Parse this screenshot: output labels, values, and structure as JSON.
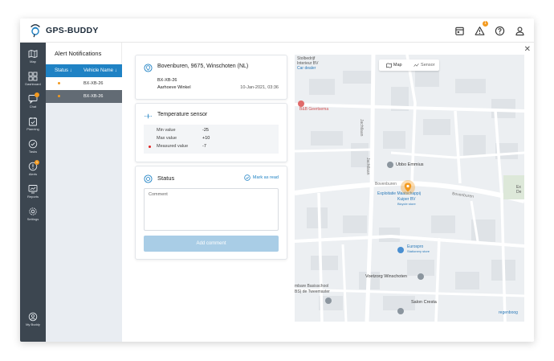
{
  "app": {
    "brand": "GPS-BUDDY",
    "notification_count": "1"
  },
  "topbar": {
    "icons": [
      "calendar-icon",
      "warning-icon",
      "help-icon",
      "user-icon"
    ]
  },
  "sidebar": {
    "items": [
      {
        "label": "Map",
        "icon": "map-icon"
      },
      {
        "label": "Dashboard",
        "icon": "dashboard-icon"
      },
      {
        "label": "Chat",
        "icon": "chat-icon"
      },
      {
        "label": "Planning",
        "icon": "planning-icon"
      },
      {
        "label": "Tasks",
        "icon": "tasks-icon"
      },
      {
        "label": "Alerts",
        "icon": "alerts-icon",
        "badge": "1"
      },
      {
        "label": "Reports",
        "icon": "reports-icon"
      },
      {
        "label": "Settings",
        "icon": "settings-icon"
      }
    ],
    "footer": {
      "label": "My Buddy",
      "icon": "my-buddy-icon"
    }
  },
  "alerts": {
    "title": "Alert Notifications",
    "columns": {
      "status": "Status",
      "vehicle": "Vehicle Name"
    },
    "rows": [
      {
        "vehicle": "BX-XB-26"
      },
      {
        "vehicle": "BX-XB-26"
      }
    ]
  },
  "location": {
    "address": "Bovenburen, 9675, Winschoten (NL)",
    "vehicle": "BX-XB-26",
    "place": "Aarhoeve Winkel",
    "datetime": "10-Jan-2021, 03:36"
  },
  "sensor": {
    "title": "Temperature sensor",
    "rows": [
      {
        "label": "Min value",
        "value": "-25"
      },
      {
        "label": "Max value",
        "value": "+10"
      },
      {
        "label": "Measured value",
        "value": "-7"
      }
    ]
  },
  "status": {
    "title": "Status",
    "mark_read": "Mark as read",
    "comment_placeholder": "Comment",
    "add_button": "Add comment"
  },
  "map": {
    "toggle": {
      "map": "Map",
      "sensor": "Sensor"
    },
    "labels": {
      "bovenburen_1": "Bovenburen",
      "bovenburen_2": "Bovenburen",
      "company": "Exploitatie Maatschappij",
      "company_2": "Kuiper BV",
      "company_3": "Bicycle store",
      "ubbo": "Ubbo Emmius",
      "eurospro": "Eurospro",
      "eurospro_2": "Stationery store",
      "voetzorg": "Voetzorg Winschoten",
      "salon": "Salon Cresta",
      "school_1": "mbare Basisschool",
      "school_2": "BS) de Tweemaster",
      "bb": "B&B Geertsema",
      "jacht_1": "Jachtlaan",
      "jacht_2": "Jachtlaan",
      "tl_1": "Stolbedrijf",
      "tl_2": "Interieur BV",
      "tl_3": "Car dealer",
      "regenboog": "regenboog",
      "right_1": "Ex",
      "right_2": "De"
    }
  }
}
